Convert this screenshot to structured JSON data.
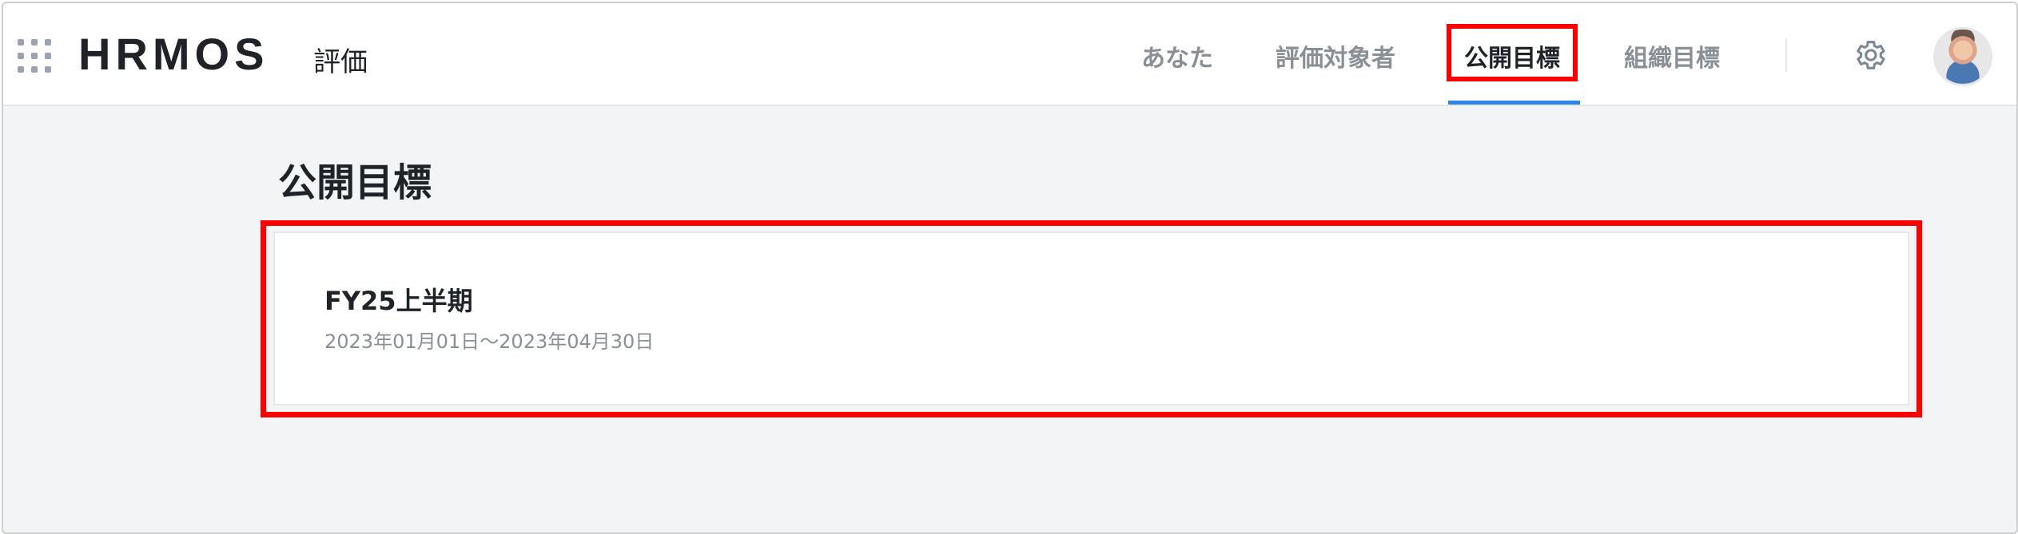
{
  "header": {
    "logo_text": "HRMOS",
    "product_name": "評価",
    "nav": [
      {
        "label": "あなた"
      },
      {
        "label": "評価対象者"
      },
      {
        "label": "公開目標",
        "active": true
      },
      {
        "label": "組織目標"
      }
    ],
    "icons": {
      "apps": "app-grid-icon",
      "settings": "gear-icon",
      "profile": "avatar"
    }
  },
  "main": {
    "title": "公開目標",
    "cards": [
      {
        "title": "FY25上半期",
        "period": "2023年01月01日〜2023年04月30日"
      }
    ]
  },
  "colors": {
    "highlight": "#ff0000",
    "active_underline": "#2f86e6",
    "background": "#f3f4f6"
  }
}
